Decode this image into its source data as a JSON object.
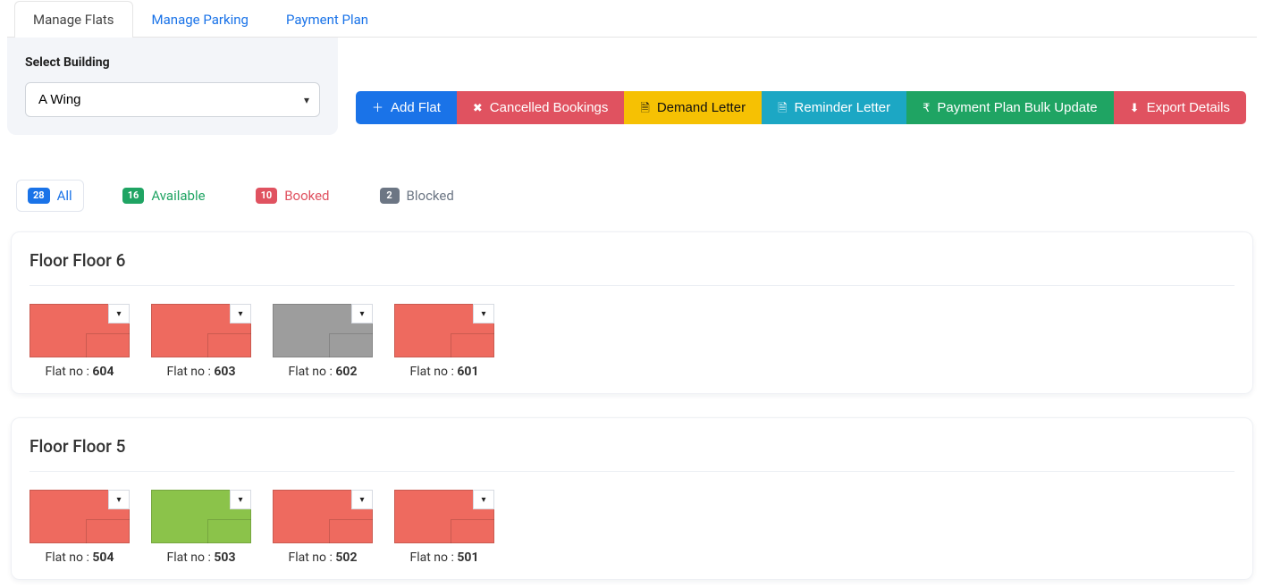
{
  "tabs": {
    "manage_flats": "Manage Flats",
    "manage_parking": "Manage Parking",
    "payment_plan": "Payment Plan"
  },
  "building": {
    "label": "Select Building",
    "selected": "A Wing"
  },
  "toolbar": {
    "add_flat": "Add Flat",
    "cancelled_bookings": "Cancelled Bookings",
    "demand_letter": "Demand Letter",
    "reminder_letter": "Reminder Letter",
    "payment_plan_bulk": "Payment Plan Bulk Update",
    "export_details": "Export Details"
  },
  "filters": {
    "all": {
      "count": "28",
      "label": "All"
    },
    "available": {
      "count": "16",
      "label": "Available"
    },
    "booked": {
      "count": "10",
      "label": "Booked"
    },
    "blocked": {
      "count": "2",
      "label": "Blocked"
    }
  },
  "floors": {
    "f6": {
      "title": "Floor Floor 6",
      "flats": {
        "0": {
          "prefix": "Flat no : ",
          "no": "604",
          "status": "booked"
        },
        "1": {
          "prefix": "Flat no : ",
          "no": "603",
          "status": "booked"
        },
        "2": {
          "prefix": "Flat no : ",
          "no": "602",
          "status": "blocked"
        },
        "3": {
          "prefix": "Flat no : ",
          "no": "601",
          "status": "booked"
        }
      }
    },
    "f5": {
      "title": "Floor Floor 5",
      "flats": {
        "0": {
          "prefix": "Flat no : ",
          "no": "504",
          "status": "booked"
        },
        "1": {
          "prefix": "Flat no : ",
          "no": "503",
          "status": "available"
        },
        "2": {
          "prefix": "Flat no : ",
          "no": "502",
          "status": "booked"
        },
        "3": {
          "prefix": "Flat no : ",
          "no": "501",
          "status": "booked"
        }
      }
    }
  }
}
